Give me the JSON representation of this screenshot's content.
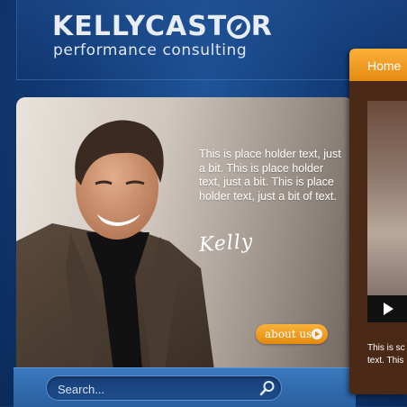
{
  "header": {
    "logo_word1": "KELLY",
    "logo_word2_a": "CAST",
    "logo_word2_b": "R",
    "tagline": "performance consulting"
  },
  "hero": {
    "body_text": "This is place holder text, just a bit. This is place holder text, just a bit. This is place holder text, just a bit of text.",
    "signature": "Kelly",
    "about_button": "about us"
  },
  "search": {
    "placeholder": "Search..."
  },
  "side_panel": {
    "tab_label": "Home",
    "text_line1": "This is sc",
    "text_line2": "text. This"
  },
  "colors": {
    "background": "#123c78",
    "accent_orange": "#f29a1f",
    "panel_brown": "#4a2a17"
  },
  "icons": [
    "compass-icon",
    "search-icon",
    "play-icon",
    "arrow-right-icon"
  ]
}
